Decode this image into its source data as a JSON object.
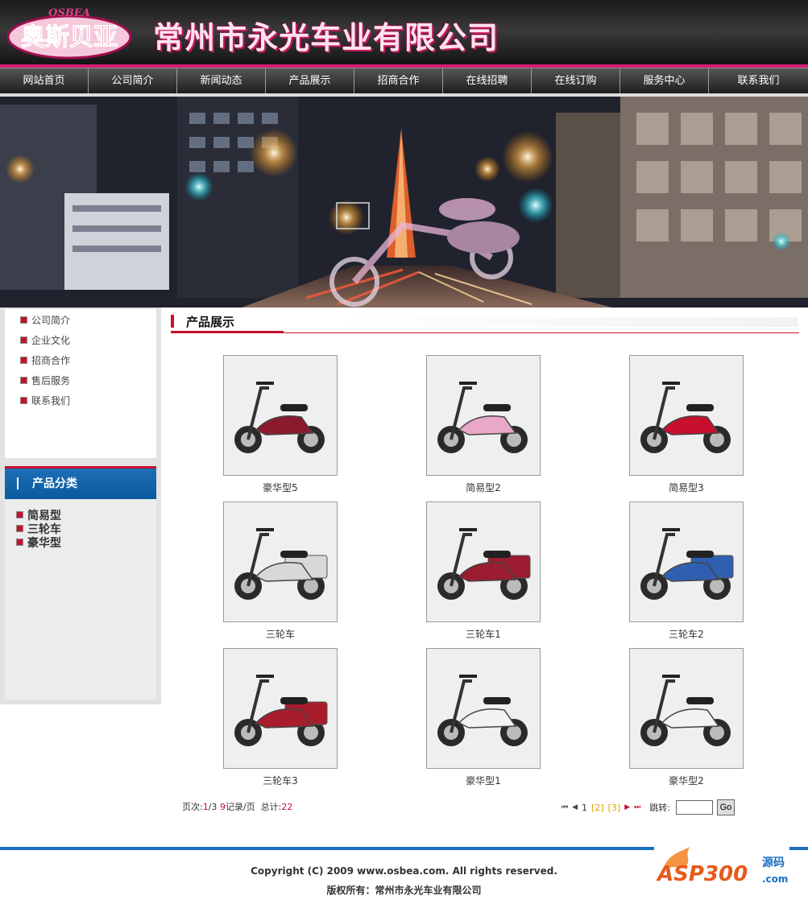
{
  "header": {
    "logo_text": "奥斯贝亚",
    "logo_subtext": "OSBEA",
    "company_name": "常州市永光车业有限公司"
  },
  "nav": [
    {
      "label": "网站首页"
    },
    {
      "label": "公司简介"
    },
    {
      "label": "新闻动态"
    },
    {
      "label": "产品展示"
    },
    {
      "label": "招商合作"
    },
    {
      "label": "在线招聘"
    },
    {
      "label": "在线订购"
    },
    {
      "label": "服务中心"
    },
    {
      "label": "联系我们"
    }
  ],
  "sidebar": {
    "links": [
      {
        "label": "公司简介"
      },
      {
        "label": "企业文化"
      },
      {
        "label": "招商合作"
      },
      {
        "label": "售后服务"
      },
      {
        "label": "联系我们"
      }
    ],
    "category_title": "产品分类",
    "categories": [
      {
        "label": "简易型"
      },
      {
        "label": "三轮车"
      },
      {
        "label": "豪华型"
      }
    ]
  },
  "main": {
    "section_title": "产品展示",
    "products": [
      {
        "name": "豪华型5",
        "color": "#8b1a2e"
      },
      {
        "name": "简易型2",
        "color": "#e9a8c8"
      },
      {
        "name": "简易型3",
        "color": "#c8102e"
      },
      {
        "name": "三轮车",
        "color": "#d8d8d8"
      },
      {
        "name": "三轮车1",
        "color": "#9b1b30"
      },
      {
        "name": "三轮车2",
        "color": "#2f5fb0"
      },
      {
        "name": "三轮车3",
        "color": "#a81c2c"
      },
      {
        "name": "豪华型1",
        "color": "#f2f2f2"
      },
      {
        "name": "豪华型2",
        "color": "#f2f2f2"
      }
    ]
  },
  "pager": {
    "page_label": "页次:",
    "current": "1",
    "total_pages": "/3",
    "per_page": "9",
    "per_page_label": "记录/页",
    "total_label": "总计:",
    "total": "22",
    "current_page": "1",
    "page2": "[2]",
    "page3": "[3]",
    "jump_label": "跳转:",
    "go_label": "Go"
  },
  "footer": {
    "copyright": "Copyright (C) 2009 www.osbea.com. All rights reserved.",
    "owner": "版权所有：常州市永光车业有限公司",
    "badge_text": "ASP300",
    "badge_sub": "源码",
    "badge_domain": ".com"
  }
}
